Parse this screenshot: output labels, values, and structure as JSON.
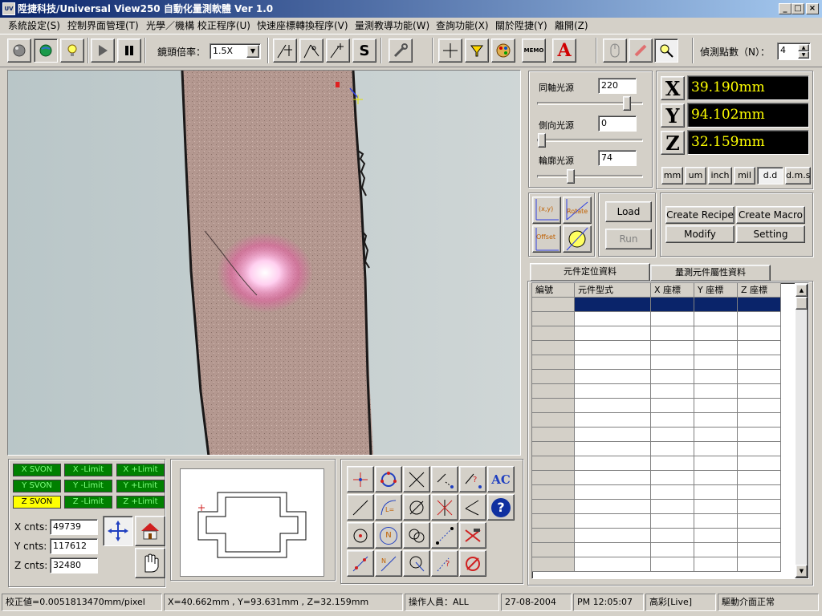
{
  "window": {
    "title": "陞捷科技/Universal View250 自動化量測軟體 Ver 1.0",
    "app_icon_text": "UV",
    "min_glyph": "_",
    "max_glyph": "□",
    "close_glyph": "×"
  },
  "menu": [
    "系統設定(S)",
    "控制界面管理(T)",
    "光學／機構 校正程序(U)",
    "快速座標轉換程序(V)",
    "量測教導功能(W)",
    "查詢功能(X)",
    "關於陞捷(Y)",
    "離開(Z)"
  ],
  "toolbar": {
    "zoom_label": "鏡頭倍率：",
    "zoom_value": "1.5X",
    "points_label": "偵測點數（N）：",
    "points_value": "4",
    "icon_text_s": "S",
    "icon_text_memo": "MEMO",
    "icon_text_a": "A"
  },
  "lights": {
    "coaxial_label": "同軸光源",
    "coaxial_value": "220",
    "side_label": "側向光源",
    "side_value": "0",
    "contour_label": "輪廓光源",
    "contour_value": "74"
  },
  "coords": {
    "x_label": "X",
    "x_value": "39.190mm",
    "y_label": "Y",
    "y_value": "94.102mm",
    "z_label": "Z",
    "z_value": "32.159mm"
  },
  "units": [
    "mm",
    "um",
    "inch",
    "mil",
    "d.d",
    "d.m.s"
  ],
  "transform_icons": {
    "xy": "(x,y)",
    "rotate": "Rotate",
    "offset": "Offset"
  },
  "recipe": {
    "load": "Load",
    "run": "Run",
    "create_recipe": "Create Recipe",
    "create_macro": "Create Macro",
    "modify": "Modify",
    "setting": "Setting"
  },
  "tabs": [
    "元件定位資料",
    "量測元件屬性資料"
  ],
  "table": {
    "columns": [
      "編號",
      "元件型式",
      "X 座標",
      "Y 座標",
      "Z 座標"
    ],
    "row_count": 19
  },
  "status_leds": [
    {
      "text": "X SVON",
      "color": "#008000"
    },
    {
      "text": "X -Limit",
      "color": "#008000"
    },
    {
      "text": "X +Limit",
      "color": "#008000"
    },
    {
      "text": "Y SVON",
      "color": "#008000"
    },
    {
      "text": "Y -Limit",
      "color": "#008000"
    },
    {
      "text": "Y +Limit",
      "color": "#008000"
    },
    {
      "text": "Z SVON",
      "color": "#ffff00"
    },
    {
      "text": "Z -Limit",
      "color": "#008000"
    },
    {
      "text": "Z +Limit",
      "color": "#008000"
    }
  ],
  "counts": {
    "x_label": "X cnts:",
    "x_value": "49739",
    "y_label": "Y cnts:",
    "y_value": "117612",
    "z_label": "Z cnts:",
    "z_value": "32480"
  },
  "tool_text": {
    "ac": "AC",
    "help": "?",
    "n": "N"
  },
  "status": {
    "calibration": "校正値=0.0051813470mm/pixel",
    "position": "X=40.662mm , Y=93.631mm , Z=32.159mm",
    "operator": "操作人員：ALL",
    "date": "27-08-2004",
    "time": "PM 12:05:07",
    "color_mode": "高彩[Live]",
    "driver": "驅動介面正常"
  },
  "colors": {
    "accent_title": "#0a246a",
    "led_green": "#008000",
    "led_yellow": "#ffff00",
    "coord_text": "#ffff00",
    "selected_row": "#0a246a"
  }
}
